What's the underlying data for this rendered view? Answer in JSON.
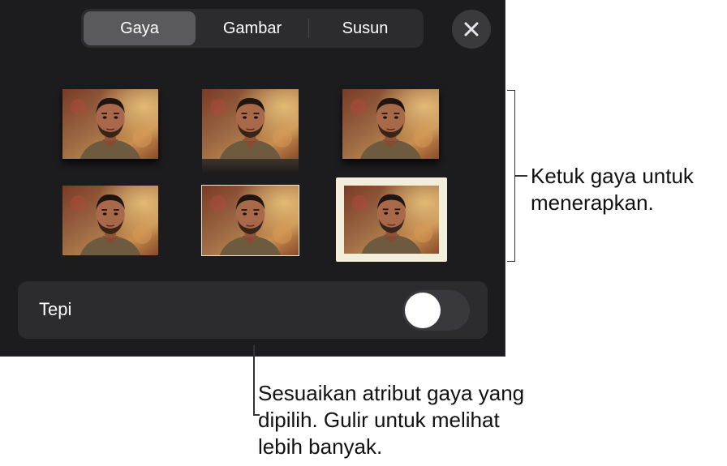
{
  "tabs": [
    {
      "label": "Gaya",
      "active": true
    },
    {
      "label": "Gambar",
      "active": false
    },
    {
      "label": "Susun",
      "active": false
    }
  ],
  "close_icon": "close-icon",
  "styles": [
    {
      "name": "shadow"
    },
    {
      "name": "reflection"
    },
    {
      "name": "shadow"
    },
    {
      "name": "plain"
    },
    {
      "name": "thin-border"
    },
    {
      "name": "mat-frame"
    }
  ],
  "tepi": {
    "label": "Tepi",
    "toggle_on": false
  },
  "callouts": {
    "styles": {
      "line1": "Ketuk gaya untuk",
      "line2": "menerapkan."
    },
    "attributes": {
      "line1": "Sesuaikan atribut gaya yang",
      "line2": "dipilih. Gulir untuk melihat",
      "line3": "lebih banyak."
    }
  },
  "colors": {
    "panel_background": "#1c1c1e",
    "control_background": "#2c2c2e",
    "active_tab": "#5a5a5e",
    "toggle_off": "#39393d",
    "mat_frame": "#f3eedc"
  }
}
